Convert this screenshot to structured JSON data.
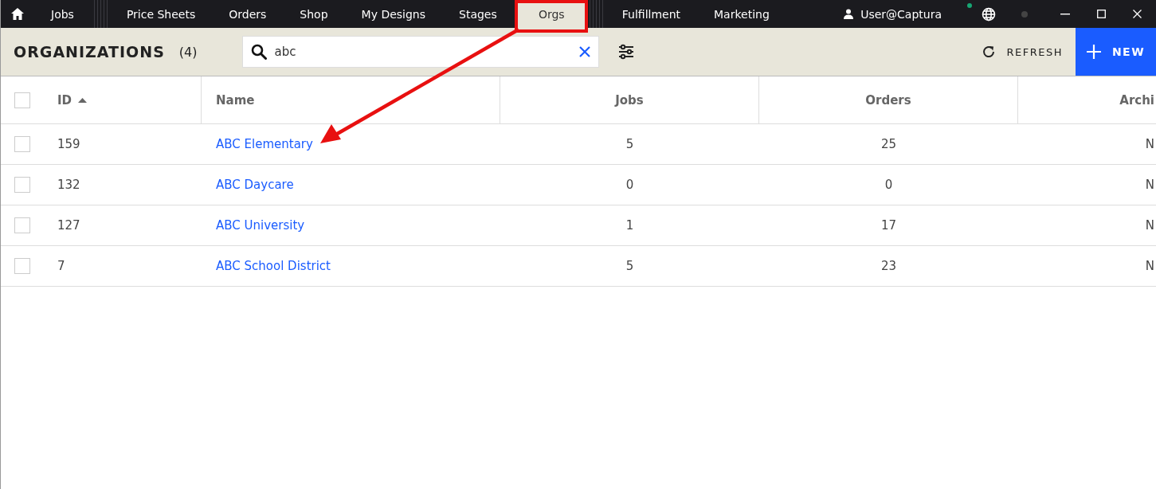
{
  "nav_groups": [
    [
      {
        "label": "Jobs",
        "selected": false
      }
    ],
    [
      {
        "label": "Price Sheets",
        "selected": false
      },
      {
        "label": "Orders",
        "selected": false
      },
      {
        "label": "Shop",
        "selected": false
      },
      {
        "label": "My Designs",
        "selected": false
      },
      {
        "label": "Stages",
        "selected": false
      },
      {
        "label": "Orgs",
        "selected": true
      }
    ],
    [
      {
        "label": "Fulfillment",
        "selected": false
      },
      {
        "label": "Marketing",
        "selected": false
      }
    ]
  ],
  "user": {
    "name": "User@Captura"
  },
  "header": {
    "title": "ORGANIZATIONS",
    "count": "(4)",
    "search": {
      "value": "abc"
    },
    "refresh": "REFRESH",
    "new": "NEW"
  },
  "table": {
    "all_checked": false,
    "columns": [
      {
        "label": "ID",
        "sorted": true
      },
      {
        "label": "Name",
        "sorted": false
      },
      {
        "label": "Jobs",
        "sorted": false
      },
      {
        "label": "Orders",
        "sorted": false
      },
      {
        "label": "Archi",
        "sorted": false
      }
    ],
    "rows": [
      {
        "checked": false,
        "cells": [
          "159",
          "ABC Elementary",
          "5",
          "25",
          "N"
        ]
      },
      {
        "checked": false,
        "cells": [
          "132",
          "ABC Daycare",
          "0",
          "0",
          "N"
        ]
      },
      {
        "checked": false,
        "cells": [
          "127",
          "ABC University",
          "1",
          "17",
          "N"
        ]
      },
      {
        "checked": false,
        "cells": [
          "7",
          "ABC School District",
          "5",
          "23",
          "N"
        ]
      }
    ]
  }
}
